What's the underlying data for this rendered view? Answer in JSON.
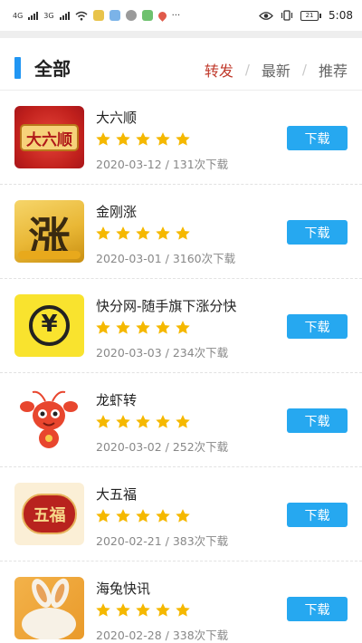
{
  "status_bar": {
    "network_left": "4G",
    "network_right": "3G",
    "more": "···",
    "battery": "21",
    "time": "5:08"
  },
  "header": {
    "title": "全部",
    "tabs": [
      {
        "label": "转发",
        "active": true
      },
      {
        "label": "最新",
        "active": false
      },
      {
        "label": "推荐",
        "active": false
      }
    ]
  },
  "apps": [
    {
      "name": "大六顺",
      "date": "2020-03-12",
      "downloads": "131次下载",
      "stars": 5,
      "button": "下载",
      "icon_text": "大六顺",
      "icon_name": "daliushun-app-icon"
    },
    {
      "name": "金刚涨",
      "date": "2020-03-01",
      "downloads": "3160次下载",
      "stars": 5,
      "button": "下载",
      "icon_text": "涨",
      "icon_name": "jingangzhang-app-icon"
    },
    {
      "name": "快分网-随手旗下涨分快",
      "date": "2020-03-03",
      "downloads": "234次下载",
      "stars": 5,
      "button": "下载",
      "icon_text": "¥",
      "icon_name": "kuaifen-app-icon"
    },
    {
      "name": "龙虾转",
      "date": "2020-03-02",
      "downloads": "252次下载",
      "stars": 5,
      "button": "下载",
      "icon_text": "",
      "icon_name": "lobster-app-icon"
    },
    {
      "name": "大五福",
      "date": "2020-02-21",
      "downloads": "383次下载",
      "stars": 5,
      "button": "下载",
      "icon_text": "五福",
      "icon_name": "dawufu-app-icon"
    },
    {
      "name": "海兔快讯",
      "date": "2020-02-28",
      "downloads": "338次下载",
      "stars": 5,
      "button": "下载",
      "icon_text": "",
      "icon_name": "haitu-app-icon"
    }
  ],
  "colors": {
    "accent": "#2196f3",
    "active_tab": "#c0392b",
    "download_button": "#26a8f0",
    "star": "#f5b800"
  }
}
